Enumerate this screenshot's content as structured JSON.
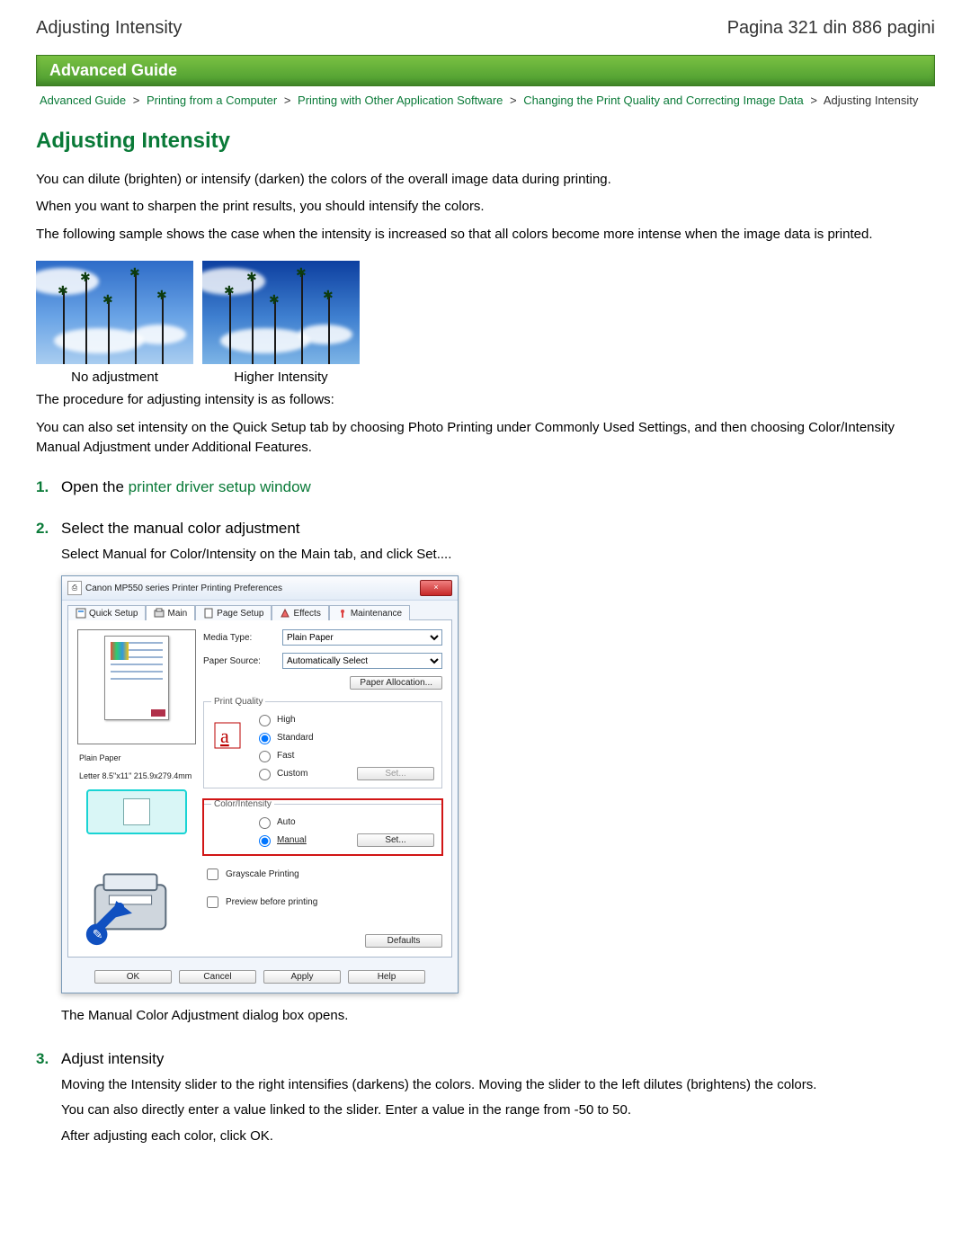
{
  "header": {
    "title_left": "Adjusting Intensity",
    "page_info": "Pagina 321 din 886 pagini"
  },
  "banner": "Advanced Guide",
  "breadcrumb": {
    "items": [
      "Advanced Guide",
      "Printing from a Computer",
      "Printing with Other Application Software",
      "Changing the Print Quality and Correcting Image Data"
    ],
    "current": "Adjusting Intensity",
    "sep": ">"
  },
  "title": "Adjusting Intensity",
  "intro": {
    "p1": "You can dilute (brighten) or intensify (darken) the colors of the overall image data during printing.",
    "p2": "When you want to sharpen the print results, you should intensify the colors.",
    "p3": "The following sample shows the case when the intensity is increased so that all colors become more intense when the image data is printed."
  },
  "samples": {
    "caption_left": "No adjustment",
    "caption_right": "Higher Intensity"
  },
  "after_sample": {
    "p1": "The procedure for adjusting intensity is as follows:",
    "p2": "You can also set intensity on the Quick Setup tab by choosing Photo Printing under Commonly Used Settings, and then choosing Color/Intensity Manual Adjustment under Additional Features."
  },
  "steps": [
    {
      "num": "1.",
      "title_before": "Open the ",
      "title_link": "printer driver setup window"
    },
    {
      "num": "2.",
      "title": "Select the manual color adjustment",
      "body1": "Select Manual for Color/Intensity on the Main tab, and click Set....",
      "body2": "The Manual Color Adjustment dialog box opens."
    },
    {
      "num": "3.",
      "title": "Adjust intensity",
      "body1": "Moving the Intensity slider to the right intensifies (darkens) the colors. Moving the slider to the left dilutes (brightens) the colors.",
      "body2": "You can also directly enter a value linked to the slider. Enter a value in the range from -50 to 50.",
      "body3": "After adjusting each color, click OK."
    }
  ],
  "dialog": {
    "title": "Canon MP550 series Printer Printing Preferences",
    "close_label": "×",
    "tabs": [
      "Quick Setup",
      "Main",
      "Page Setup",
      "Effects",
      "Maintenance"
    ],
    "media_type_label": "Media Type:",
    "media_type_value": "Plain Paper",
    "paper_source_label": "Paper Source:",
    "paper_source_value": "Automatically Select",
    "paper_allocation": "Paper Allocation...",
    "print_quality": {
      "legend": "Print Quality",
      "options": [
        "High",
        "Standard",
        "Fast",
        "Custom"
      ],
      "selected": "Standard",
      "set": "Set..."
    },
    "color_intensity": {
      "legend": "Color/Intensity",
      "options": [
        "Auto",
        "Manual"
      ],
      "selected": "Manual",
      "set": "Set..."
    },
    "grayscale": "Grayscale Printing",
    "preview_before": "Preview before printing",
    "preview_label1": "Plain Paper",
    "preview_label2": "Letter 8.5\"x11\" 215.9x279.4mm",
    "defaults": "Defaults",
    "footer": [
      "OK",
      "Cancel",
      "Apply",
      "Help"
    ]
  }
}
